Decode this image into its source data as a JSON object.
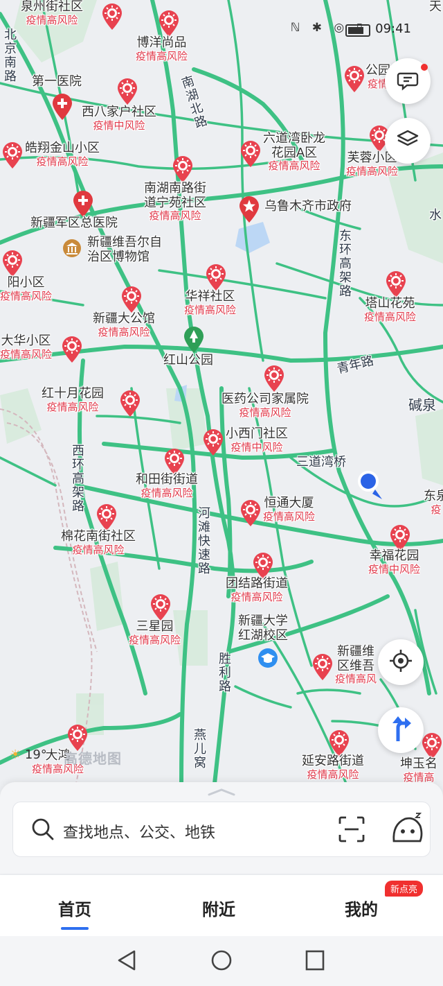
{
  "status": {
    "time": "09:41"
  },
  "map": {
    "pois": [
      {
        "id": "quanzhou",
        "name": "泉州街社区",
        "risk": "疫情高风险"
      },
      {
        "id": "boyang",
        "name": "博洋尚品",
        "risk": "疫情高风险"
      },
      {
        "id": "gongyuan",
        "name": "公园",
        "risk": "疫情"
      },
      {
        "id": "tian",
        "name": "天",
        "risk": ""
      },
      {
        "id": "hospital1",
        "name": "第一医院",
        "risk": ""
      },
      {
        "id": "xibajiahu",
        "name": "西八家户社区",
        "risk": "疫情中风险"
      },
      {
        "id": "haoxiang",
        "name": "皓翔金山小区",
        "risk": "疫情高风险"
      },
      {
        "id": "liudaowan",
        "name": "六道湾卧龙\n花园A区",
        "risk": "疫情高风险"
      },
      {
        "id": "furong",
        "name": "芙蓉小区",
        "risk": "疫情高风险"
      },
      {
        "id": "nanhu",
        "name": "南湖南路街\n道宁苑社区",
        "risk": "疫情高风险"
      },
      {
        "id": "junqu",
        "name": "新疆军区总医院",
        "risk": ""
      },
      {
        "id": "museum",
        "name": "新疆维吾尔自\n治区博物馆",
        "risk": ""
      },
      {
        "id": "gov",
        "name": "乌鲁木齐市政府",
        "risk": ""
      },
      {
        "id": "yang",
        "name": "阳小区",
        "risk": "疫情高风险"
      },
      {
        "id": "huaxiang",
        "name": "华祥社区",
        "risk": "疫情高风险"
      },
      {
        "id": "tashan",
        "name": "塔山花苑",
        "risk": "疫情高风险"
      },
      {
        "id": "dagongguan",
        "name": "新疆大公馆",
        "risk": "疫情高风险"
      },
      {
        "id": "dahua",
        "name": "大华小区",
        "risk": "疫情高风险"
      },
      {
        "id": "hongshan",
        "name": "红山公园",
        "risk": ""
      },
      {
        "id": "yiyao",
        "name": "医药公司家属院",
        "risk": "疫情高风险"
      },
      {
        "id": "hongshiyue",
        "name": "红十月花园",
        "risk": "疫情高风险"
      },
      {
        "id": "xiaoximen",
        "name": "小西门社区",
        "risk": "疫情中风险"
      },
      {
        "id": "hetian",
        "name": "和田街街道",
        "risk": "疫情高风险"
      },
      {
        "id": "hengtong",
        "name": "恒通大厦",
        "risk": "疫情高风险"
      },
      {
        "id": "mianhua",
        "name": "棉花南街社区",
        "risk": "疫情高风险"
      },
      {
        "id": "xingfu",
        "name": "幸福花园",
        "risk": "疫情中风险"
      },
      {
        "id": "tuanjie",
        "name": "团结路街道",
        "risk": "疫情高风险"
      },
      {
        "id": "xinjiangu",
        "name": "新疆大学\n红湖校区",
        "risk": ""
      },
      {
        "id": "sanxing",
        "name": "三星园",
        "risk": "疫情高风险"
      },
      {
        "id": "xinjiangwei",
        "name": "新疆维\n区维吾",
        "risk": "疫情高风"
      },
      {
        "id": "dahong",
        "name": "大鸿",
        "risk": "疫情高风险"
      },
      {
        "id": "yanan",
        "name": "延安路街道",
        "risk": "疫情高风险"
      },
      {
        "id": "kunyu",
        "name": "坤玉名",
        "risk": "疫情高"
      },
      {
        "id": "east",
        "name": "东泉",
        "risk": "疫"
      }
    ],
    "roads": {
      "beijing_nan": "北京南路",
      "nanhu_bei": "南湖北路",
      "donghuan": "东环高架路",
      "qingnian": "青年路",
      "xihuan": "西环高架路",
      "hetan": "河滩快速路",
      "shengli": "胜利路",
      "yaner": "燕儿窝",
      "sandaowan": "三道湾桥",
      "jianquan": "碱泉",
      "shui": "水"
    },
    "weather": "19°",
    "logo": "高德地图"
  },
  "search": {
    "placeholder": "查找地点、公交、地铁"
  },
  "tabs": [
    {
      "label": "首页",
      "active": true
    },
    {
      "label": "附近",
      "active": false
    },
    {
      "label": "我的",
      "active": false
    }
  ],
  "badge": "新点亮",
  "icons": {
    "message": "message-icon",
    "layers": "layers-icon",
    "locate": "locate-icon",
    "route": "route-icon",
    "search": "search-icon",
    "scan": "scan-icon",
    "assistant": "assistant-icon",
    "back": "back-icon",
    "home": "home-icon",
    "recent": "recent-icon"
  },
  "colors": {
    "road": "#3ec184",
    "risk": "#e0394b",
    "accent": "#2e6ff0",
    "pin": "#e8424f"
  }
}
